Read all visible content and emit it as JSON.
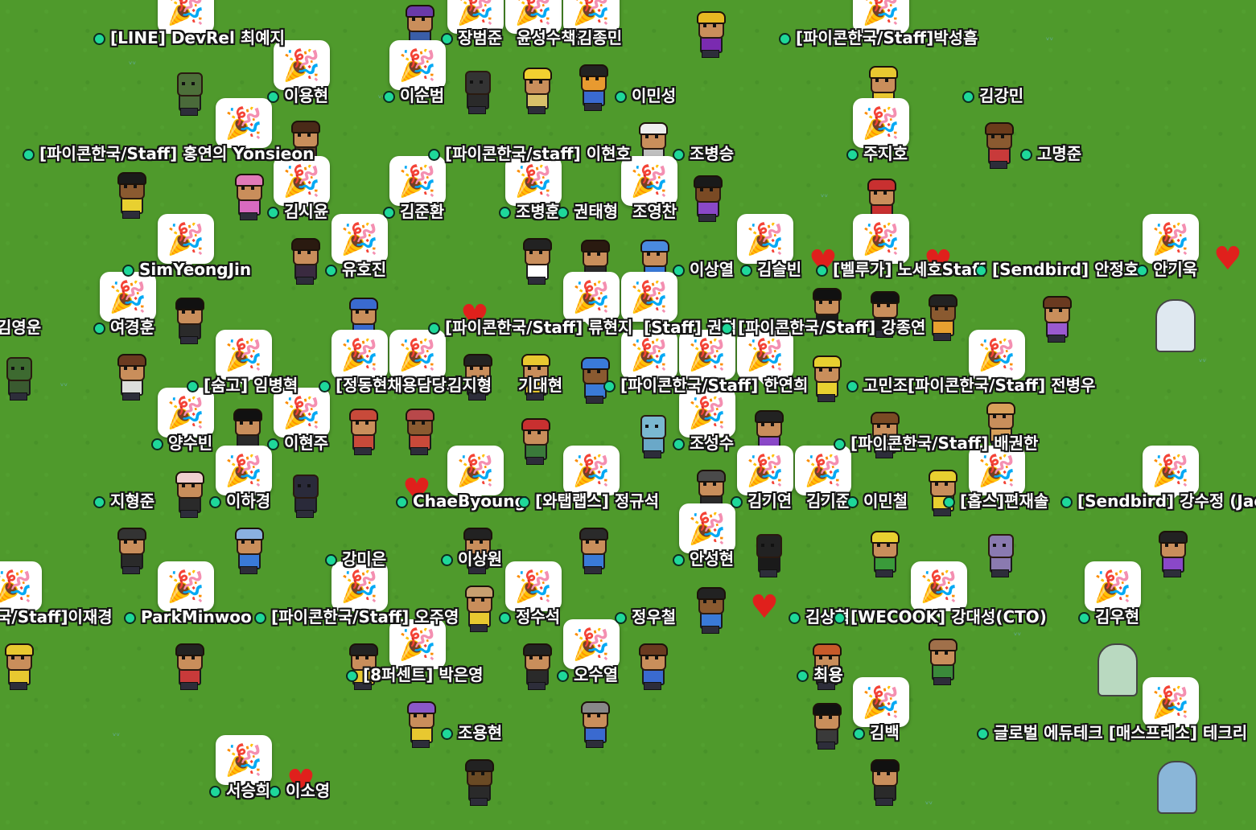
{
  "scene": {
    "grass_color": "#4f9a2c",
    "online_dot_color": "#1ed89a",
    "heart_color": "#e0201c",
    "reaction_icon": "party-popper-icon",
    "reaction_glyph": "🎉",
    "heart_glyph": "♥"
  },
  "players": [
    {
      "name": "[LINE] DevRel 최예지"
    },
    {
      "name": "장범준"
    },
    {
      "name": "윤성수책클"
    },
    {
      "name": "김종민"
    },
    {
      "name": "[파이콘한국/Staff]박성흠"
    },
    {
      "name": "이용현"
    },
    {
      "name": "이순범"
    },
    {
      "name": "이민성"
    },
    {
      "name": "김강민"
    },
    {
      "name": "[파이콘한국/Staff] 홍연의 Yonsieon"
    },
    {
      "name": "[파이콘한국/staff] 이현호"
    },
    {
      "name": "조병승"
    },
    {
      "name": "주지호"
    },
    {
      "name": "고명준"
    },
    {
      "name": "김시윤"
    },
    {
      "name": "김준환"
    },
    {
      "name": "조병훈"
    },
    {
      "name": "권태형"
    },
    {
      "name": "조영찬"
    },
    {
      "name": "SimYeongJin"
    },
    {
      "name": "유호진"
    },
    {
      "name": "이상열"
    },
    {
      "name": "김슬빈"
    },
    {
      "name": "[벨루가] 노세호Staff"
    },
    {
      "name": "[Sendbird] 안정호"
    },
    {
      "name": "안기욱"
    },
    {
      "name": "김영운"
    },
    {
      "name": "여경훈"
    },
    {
      "name": "[파이콘한국/Staff] 류현지"
    },
    {
      "name": "[Staff] 권혁"
    },
    {
      "name": "[파이콘한국/Staff] 강종연"
    },
    {
      "name": "[숨고] 임병혁"
    },
    {
      "name": "[정동현채용담당자"
    },
    {
      "name": "김지형"
    },
    {
      "name": "기대현"
    },
    {
      "name": "[파이콘한국/Staff] 한연희"
    },
    {
      "name": "고민조"
    },
    {
      "name": "[파이콘한국/Staff] 전병우"
    },
    {
      "name": "양수빈"
    },
    {
      "name": "이현주"
    },
    {
      "name": "조성수"
    },
    {
      "name": "[파이콘한국/Staff] 배권한"
    },
    {
      "name": "지형준"
    },
    {
      "name": "이하경"
    },
    {
      "name": "ChaeByoung"
    },
    {
      "name": "[와탭랩스] 정규석"
    },
    {
      "name": "김기연"
    },
    {
      "name": "김기준"
    },
    {
      "name": "이민철"
    },
    {
      "name": "[홉스]편재솔"
    },
    {
      "name": "[Sendbird] 강수정 (Jac"
    },
    {
      "name": "강미은"
    },
    {
      "name": "이상원"
    },
    {
      "name": "안성현"
    },
    {
      "name": "국/Staff]이재경"
    },
    {
      "name": "ParkMinwoo"
    },
    {
      "name": "[파이콘한국/Staff] 오주영"
    },
    {
      "name": "정수석"
    },
    {
      "name": "정우철"
    },
    {
      "name": "김상혁"
    },
    {
      "name": "[WECOOK] 강대성(CTO)"
    },
    {
      "name": "김우현"
    },
    {
      "name": "[8퍼센트] 박은영"
    },
    {
      "name": "오수열"
    },
    {
      "name": "최용"
    },
    {
      "name": "조용현"
    },
    {
      "name": "김백"
    },
    {
      "name": "글로벌 에듀테크 [매스프레소] 테크리"
    },
    {
      "name": "서승희"
    },
    {
      "name": "이소영"
    }
  ]
}
